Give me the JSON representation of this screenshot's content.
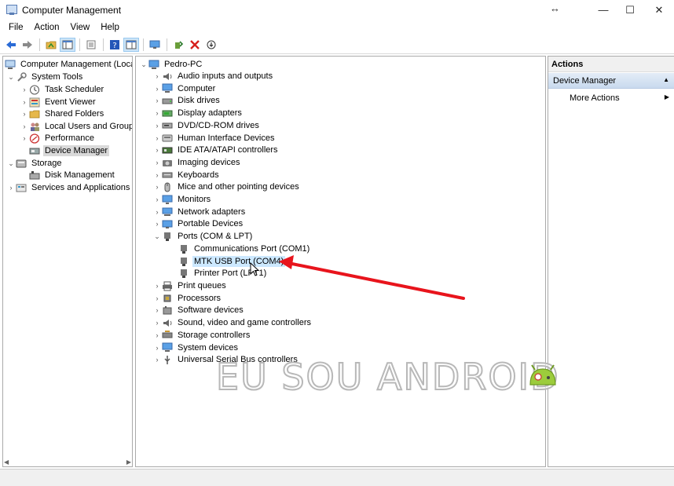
{
  "window": {
    "title": "Computer Management",
    "controls": {
      "resize": "↔",
      "minimize": "—",
      "maximize": "☐",
      "close": "✕"
    }
  },
  "menu": [
    "File",
    "Action",
    "View",
    "Help"
  ],
  "toolbar_icons": [
    "back-arrow-icon",
    "forward-arrow-icon",
    "up-folder-icon",
    "show-hide-tree-icon",
    "properties-icon",
    "help-icon",
    "view-icon",
    "monitor-icon",
    "update-driver-icon",
    "uninstall-icon",
    "scan-hardware-icon"
  ],
  "left_tree": {
    "root": "Computer Management (Local",
    "items": [
      "System Tools",
      "Task Scheduler",
      "Event Viewer",
      "Shared Folders",
      "Local Users and Groups",
      "Performance",
      "Device Manager",
      "Storage",
      "Disk Management",
      "Services and Applications"
    ]
  },
  "devices": {
    "root": "Pedro-PC",
    "categories": [
      "Audio inputs and outputs",
      "Computer",
      "Disk drives",
      "Display adapters",
      "DVD/CD-ROM drives",
      "Human Interface Devices",
      "IDE ATA/ATAPI controllers",
      "Imaging devices",
      "Keyboards",
      "Mice and other pointing devices",
      "Monitors",
      "Network adapters",
      "Portable Devices",
      "Ports (COM & LPT)"
    ],
    "ports": [
      "Communications Port (COM1)",
      "MTK USB Port (COM4)",
      "Printer Port (LPT1)"
    ],
    "more_categories": [
      "Print queues",
      "Processors",
      "Software devices",
      "Sound, video and game controllers",
      "Storage controllers",
      "System devices",
      "Universal Serial Bus controllers"
    ]
  },
  "actions": {
    "header": "Actions",
    "section": "Device Manager",
    "item": "More Actions"
  },
  "watermark": "EU SOU ANDROID",
  "colors": {
    "arrow": "#e8141c",
    "selection": "#cce8ff",
    "accent": "#1e7ad6"
  }
}
